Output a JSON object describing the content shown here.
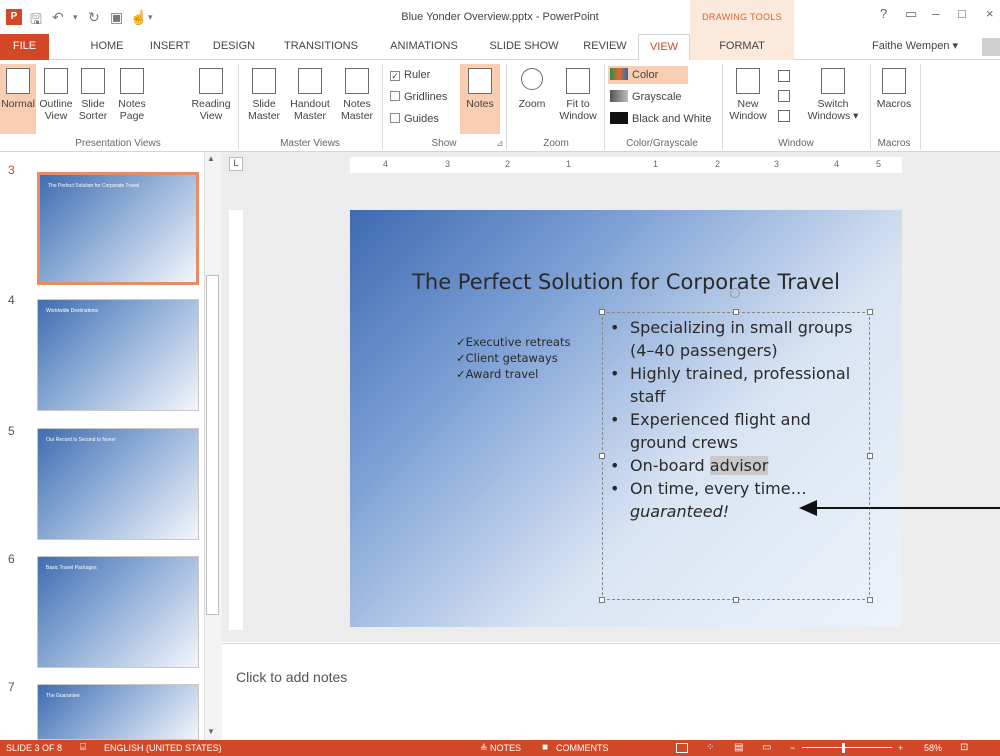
{
  "window": {
    "title": "Blue Yonder Overview.pptx - PowerPoint",
    "context_tab_group": "DRAWING TOOLS",
    "help": "?",
    "controls": [
      "▭",
      "–",
      "□",
      "×"
    ]
  },
  "tabs": {
    "file": "FILE",
    "items": [
      "HOME",
      "INSERT",
      "DESIGN",
      "TRANSITIONS",
      "ANIMATIONS",
      "SLIDE SHOW",
      "REVIEW",
      "VIEW",
      "FORMAT"
    ],
    "user": "Faithe Wempen ▾"
  },
  "ribbon": {
    "presentation_views": {
      "label": "Presentation Views",
      "normal": "Normal",
      "outline": "Outline View",
      "slide_sorter": "Slide Sorter",
      "notes_page": "Notes Page",
      "reading": "Reading View"
    },
    "master_views": {
      "label": "Master Views",
      "slide_master": "Slide Master",
      "handout_master": "Handout Master",
      "notes_master": "Notes Master"
    },
    "show": {
      "label": "Show",
      "ruler": "Ruler",
      "gridlines": "Gridlines",
      "guides": "Guides",
      "notes": "Notes",
      "ruler_checked": "✓"
    },
    "zoom": {
      "label": "Zoom",
      "zoom": "Zoom",
      "fit": "Fit to Window"
    },
    "color": {
      "label": "Color/Grayscale",
      "color": "Color",
      "grayscale": "Grayscale",
      "bw": "Black and White"
    },
    "window": {
      "label": "Window",
      "new_window": "New Window",
      "switch": "Switch Windows ▾"
    },
    "macros": {
      "label": "Macros",
      "macros": "Macros"
    }
  },
  "thumbnails": [
    {
      "number": "3",
      "title": "The Perfect Solution for Corporate Travel"
    },
    {
      "number": "4",
      "title": "Worldwide Destinations"
    },
    {
      "number": "5",
      "title": "Our Record Is Second to None!"
    },
    {
      "number": "6",
      "title": "Basic Travel Packages"
    },
    {
      "number": "7",
      "title": "The Guarantee"
    }
  ],
  "slide": {
    "title": "The Perfect Solution for Corporate Travel",
    "checks": [
      "✓Executive retreats",
      "✓Client getaways",
      "✓Award travel"
    ],
    "bullets": {
      "b1": "Specializing in small groups (4–40 passengers)",
      "b2": "Highly trained, professional staff",
      "b3": "Experienced flight and ground crews",
      "b4_pre": "On-board ",
      "b4_sel": "advisor",
      "b5_pre": "On time, every time…",
      "b5_it": "guaranteed!"
    }
  },
  "ruler": {
    "h_ticks": [
      "4",
      "3",
      "2",
      "1",
      "1",
      "2",
      "3",
      "4",
      "5"
    ]
  },
  "notes": {
    "placeholder": "Click to add notes"
  },
  "status": {
    "slide": "SLIDE 3 OF 8",
    "language": "ENGLISH (UNITED STATES)",
    "notes": "≜ NOTES",
    "comments": "COMMENTS",
    "zoom": "58%"
  }
}
